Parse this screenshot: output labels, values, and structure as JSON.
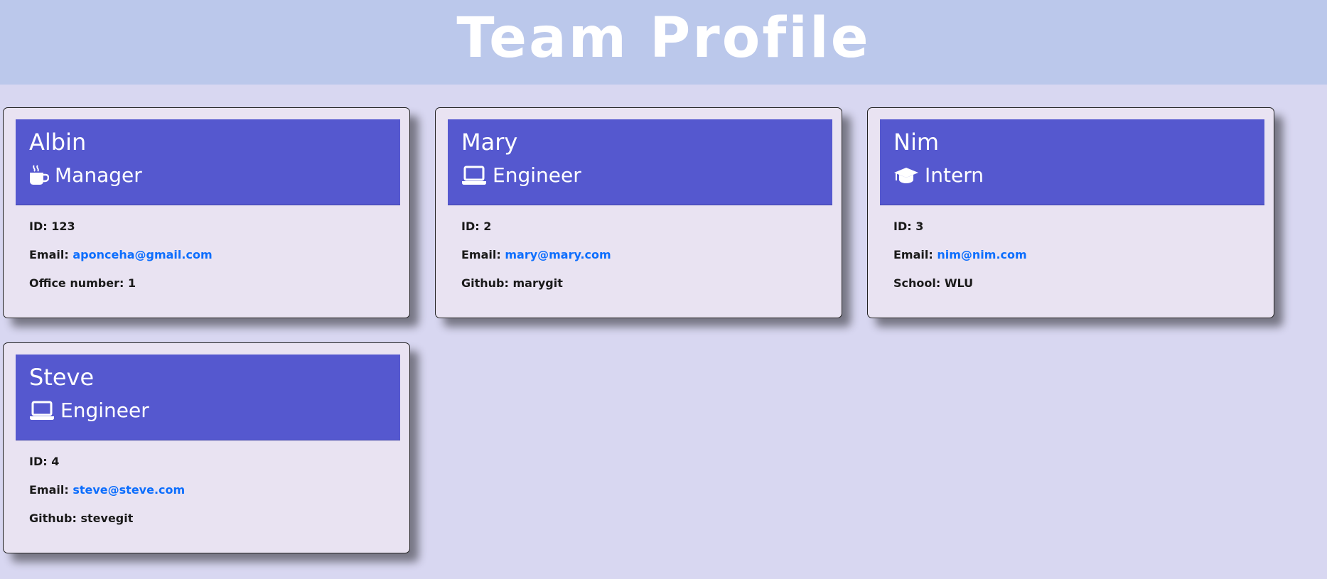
{
  "header": {
    "title": "Team Profile"
  },
  "colors": {
    "background": "#d8d7f1",
    "header_background": "#bbc8eb",
    "card_background": "#e9e3f2",
    "card_header": "#5558cf",
    "link": "#0d6efd"
  },
  "employees": [
    {
      "name": "Albin",
      "role": "Manager",
      "role_icon": "mug-hot-icon",
      "id_text": "ID: 123",
      "email_label": "Email:",
      "email": "aponceha@gmail.com",
      "extra_label": "Office number:",
      "extra_value": "1"
    },
    {
      "name": "Mary",
      "role": "Engineer",
      "role_icon": "laptop-icon",
      "id_text": "ID: 2",
      "email_label": "Email:",
      "email": "mary@mary.com",
      "extra_label": "Github:",
      "extra_value": "marygit"
    },
    {
      "name": "Nim",
      "role": "Intern",
      "role_icon": "graduation-cap-icon",
      "id_text": "ID: 3",
      "email_label": "Email:",
      "email": "nim@nim.com",
      "extra_label": "School:",
      "extra_value": "WLU"
    },
    {
      "name": "Steve",
      "role": "Engineer",
      "role_icon": "laptop-icon",
      "id_text": "ID: 4",
      "email_label": "Email:",
      "email": "steve@steve.com",
      "extra_label": "Github:",
      "extra_value": "stevegit"
    }
  ]
}
